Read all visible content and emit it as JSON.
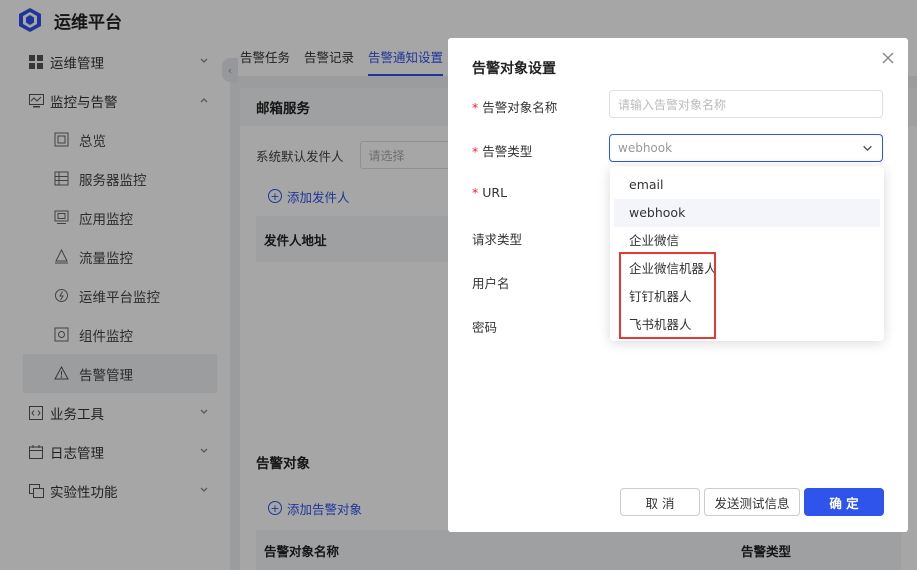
{
  "app": {
    "title": "运维平台"
  },
  "sidebar": {
    "items": [
      {
        "label": "运维管理",
        "icon": "grid-icon"
      },
      {
        "label": "监控与告警",
        "icon": "monitor-icon",
        "expanded": true,
        "children": [
          {
            "label": "总览",
            "icon": "overview-icon"
          },
          {
            "label": "服务器监控",
            "icon": "server-icon"
          },
          {
            "label": "应用监控",
            "icon": "app-icon"
          },
          {
            "label": "流量监控",
            "icon": "traffic-icon"
          },
          {
            "label": "运维平台监控",
            "icon": "platform-icon"
          },
          {
            "label": "组件监控",
            "icon": "component-icon"
          },
          {
            "label": "告警管理",
            "icon": "alarm-icon",
            "active": true
          }
        ]
      },
      {
        "label": "业务工具",
        "icon": "code-icon"
      },
      {
        "label": "日志管理",
        "icon": "calendar-icon"
      },
      {
        "label": "实验性功能",
        "icon": "lab-icon"
      }
    ]
  },
  "tabs": [
    {
      "label": "告警任务"
    },
    {
      "label": "告警记录"
    },
    {
      "label": "告警通知设置",
      "active": true
    }
  ],
  "mail_service": {
    "title": "邮箱服务",
    "default_sender_label": "系统默认发件人",
    "default_sender_placeholder": "请选择",
    "add_sender": "添加发件人",
    "col_sender_address": "发件人地址"
  },
  "alert_targets": {
    "title": "告警对象",
    "add_target": "添加告警对象",
    "col_name": "告警对象名称",
    "col_type": "告警类型"
  },
  "modal": {
    "title": "告警对象设置",
    "fields": {
      "name_label": "告警对象名称",
      "name_placeholder": "请输入告警对象名称",
      "type_label": "告警类型",
      "type_value": "webhook",
      "url_label": "URL",
      "request_type_label": "请求类型",
      "username_label": "用户名",
      "password_label": "密码"
    },
    "type_options": [
      "email",
      "webhook",
      "企业微信",
      "企业微信机器人",
      "钉钉机器人",
      "飞书机器人"
    ],
    "selected_option": "webhook",
    "buttons": {
      "cancel": "取 消",
      "send_test": "发送测试信息",
      "confirm": "确 定"
    }
  },
  "colors": {
    "accent": "#2f54eb",
    "required": "#f5222d",
    "highlight": "#e53935"
  }
}
